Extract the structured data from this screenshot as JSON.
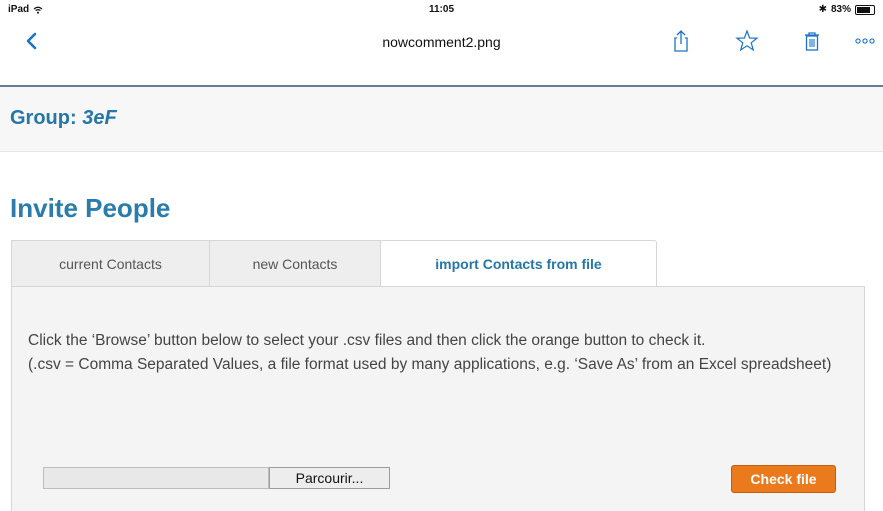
{
  "status_bar": {
    "device": "iPad",
    "time": "11:05",
    "battery": "83%",
    "battery_level": 0.83,
    "bluetooth_glyph": "✱"
  },
  "viewer": {
    "title": "nowcomment2.png",
    "icons": [
      "back-chevron-icon",
      "share-icon",
      "star-icon",
      "trash-icon",
      "more-icon"
    ]
  },
  "group": {
    "label": "Group:",
    "name": "3eF"
  },
  "section": {
    "title": "Invite People"
  },
  "tabs": [
    {
      "label": "current Contacts",
      "active": false
    },
    {
      "label": "new Contacts",
      "active": false
    },
    {
      "label": "import Contacts from file",
      "active": true
    }
  ],
  "panel": {
    "instructions_line1": "Click the ‘Browse’ button below to select your .csv files and then click the orange button to check it.",
    "instructions_line2": "(.csv = Comma Separated Values, a file format used by many applications, e.g. ‘Save As’ from an Excel spreadsheet)",
    "file_value": "",
    "browse_label": "Parcourir...",
    "check_label": "Check file"
  },
  "colors": {
    "accent_blue": "#2477a8",
    "orange_button": "#ea7a1c"
  }
}
